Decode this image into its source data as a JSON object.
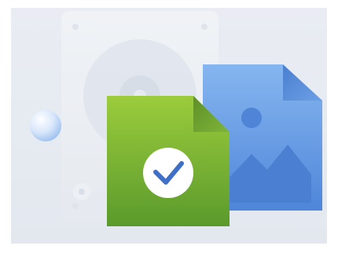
{
  "illustration": {
    "icons": [
      "hard-drive-icon",
      "image-file-icon",
      "verified-document-icon",
      "checkmark-icon",
      "sphere-icon"
    ],
    "colors": {
      "background": "#e8ecf3",
      "drive_body": "#f1f3f6",
      "image_file": "#5b9ae6",
      "verified_file": "#8cc63f",
      "checkmark": "#3f6fc6"
    }
  }
}
